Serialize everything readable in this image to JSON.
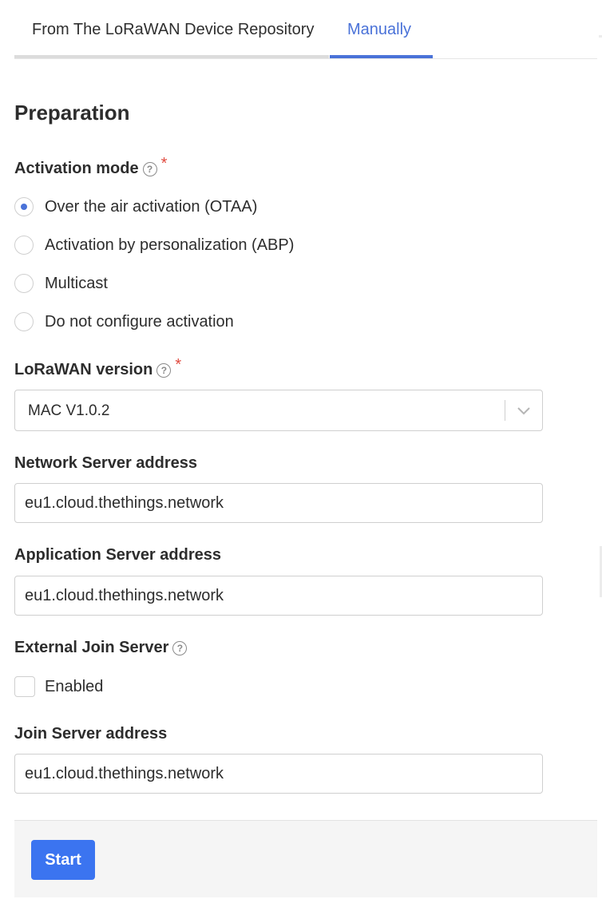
{
  "tabs": [
    {
      "label": "From The LoRaWAN Device Repository",
      "active": false
    },
    {
      "label": "Manually",
      "active": true
    }
  ],
  "section": {
    "title": "Preparation"
  },
  "activation": {
    "label": "Activation mode",
    "required_mark": "*",
    "help_icon": "help-circle-icon",
    "options": [
      {
        "label": "Over the air activation (OTAA)",
        "checked": true
      },
      {
        "label": "Activation by personalization (ABP)",
        "checked": false
      },
      {
        "label": "Multicast",
        "checked": false
      },
      {
        "label": "Do not configure activation",
        "checked": false
      }
    ]
  },
  "lorawan_version": {
    "label": "LoRaWAN version",
    "required_mark": "*",
    "help_icon": "help-circle-icon",
    "value": "MAC V1.0.2",
    "dropdown_icon": "chevron-down-icon"
  },
  "network_server": {
    "label": "Network Server address",
    "value": "eu1.cloud.thethings.network"
  },
  "application_server": {
    "label": "Application Server address",
    "value": "eu1.cloud.thethings.network"
  },
  "external_join_server": {
    "label": "External Join Server",
    "help_icon": "help-circle-icon",
    "checkbox_label": "Enabled",
    "checked": false
  },
  "join_server": {
    "label": "Join Server address",
    "value": "eu1.cloud.thethings.network"
  },
  "footer": {
    "start_label": "Start"
  },
  "colors": {
    "accent": "#4a72d8",
    "button": "#3b74f0",
    "required": "#e04a3f"
  }
}
